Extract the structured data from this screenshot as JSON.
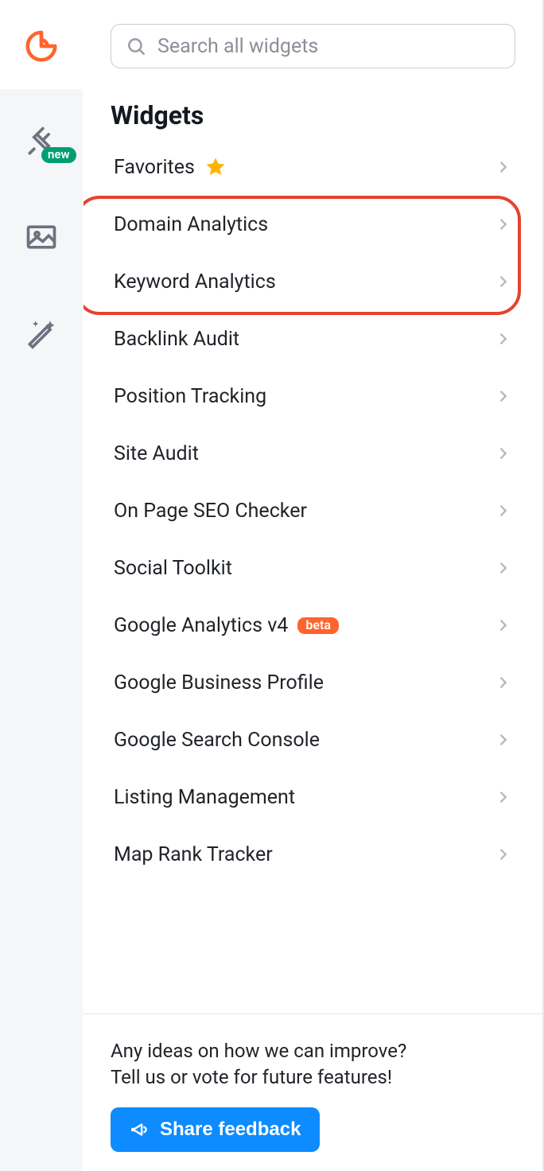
{
  "sidebar": {
    "new_badge": "new"
  },
  "search": {
    "placeholder": "Search all widgets"
  },
  "widgets": {
    "title": "Widgets",
    "items": [
      {
        "label": "Favorites",
        "icon": "star"
      },
      {
        "label": "Domain Analytics"
      },
      {
        "label": "Keyword Analytics"
      },
      {
        "label": "Backlink Audit"
      },
      {
        "label": "Position Tracking"
      },
      {
        "label": "Site Audit"
      },
      {
        "label": "On Page SEO Checker"
      },
      {
        "label": "Social Toolkit"
      },
      {
        "label": "Google Analytics v4",
        "pill": "beta"
      },
      {
        "label": "Google Business Profile"
      },
      {
        "label": "Google Search Console"
      },
      {
        "label": "Listing Management"
      },
      {
        "label": "Map Rank Tracker"
      }
    ]
  },
  "feedback": {
    "line1": "Any ideas on how we can improve?",
    "line2": "Tell us or vote for future features!",
    "button": "Share feedback"
  }
}
